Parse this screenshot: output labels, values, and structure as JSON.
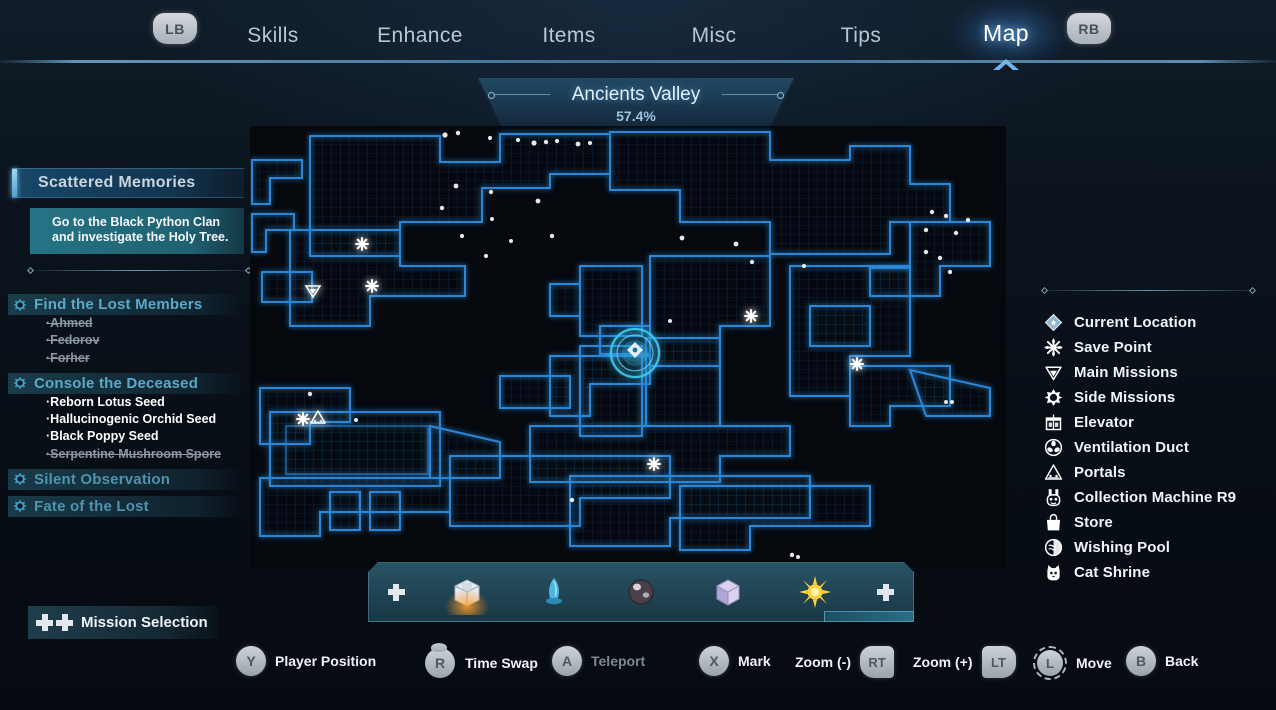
{
  "nav": {
    "left_bumper": "LB",
    "right_bumper": "RB",
    "tabs": [
      {
        "label": "Skills",
        "active": false
      },
      {
        "label": "Enhance",
        "active": false
      },
      {
        "label": "Items",
        "active": false
      },
      {
        "label": "Misc",
        "active": false
      },
      {
        "label": "Tips",
        "active": false
      },
      {
        "label": "Map",
        "active": true
      }
    ]
  },
  "quest": {
    "title": "Scattered Memories",
    "description": "Go to the Black Python Clan and investigate the Holy Tree.",
    "objectives": [
      {
        "name": "Find the Lost Members",
        "icon": "side-mission-icon",
        "items": [
          {
            "label": "Ahmed",
            "completed": true
          },
          {
            "label": "Fedorov",
            "completed": true
          },
          {
            "label": "Forher",
            "completed": true
          }
        ]
      },
      {
        "name": "Console the Deceased",
        "icon": "side-mission-icon",
        "items": [
          {
            "label": "Reborn Lotus Seed",
            "completed": false
          },
          {
            "label": "Hallucinogenic Orchid Seed",
            "completed": false
          },
          {
            "label": "Black Poppy Seed",
            "completed": false
          },
          {
            "label": "Serpentine Mushroom Spore",
            "completed": true
          }
        ]
      },
      {
        "name": "Silent Observation",
        "icon": "side-mission-icon",
        "items": []
      },
      {
        "name": "Fate of the Lost",
        "icon": "side-mission-icon",
        "items": []
      }
    ],
    "mission_selection": "Mission Selection"
  },
  "map": {
    "region_name": "Ancients Valley",
    "completion": "57.4%",
    "accent_color": "#4a9fd0",
    "wall_color": "#1e6fb8",
    "background_color": "#05080d"
  },
  "legend": {
    "entries": [
      {
        "label": "Current Location",
        "icon": "current-location-icon"
      },
      {
        "label": "Save Point",
        "icon": "save-point-icon"
      },
      {
        "label": "Main Missions",
        "icon": "main-mission-icon"
      },
      {
        "label": "Side Missions",
        "icon": "side-mission-icon"
      },
      {
        "label": "Elevator",
        "icon": "elevator-icon"
      },
      {
        "label": "Ventilation Duct",
        "icon": "ventilation-duct-icon"
      },
      {
        "label": "Portals",
        "icon": "portal-icon"
      },
      {
        "label": "Collection Machine R9",
        "icon": "collection-machine-icon"
      },
      {
        "label": "Store",
        "icon": "store-icon"
      },
      {
        "label": "Wishing Pool",
        "icon": "wishing-pool-icon"
      },
      {
        "label": "Cat Shrine",
        "icon": "cat-shrine-icon"
      }
    ]
  },
  "itembar": {
    "prev_icon": "dpad-left-icon",
    "next_icon": "dpad-right-icon",
    "items": [
      {
        "icon": "white-box-icon",
        "selected": true
      },
      {
        "icon": "blue-crystal-icon",
        "selected": false
      },
      {
        "icon": "dark-orb-icon",
        "selected": false
      },
      {
        "icon": "purple-cube-icon",
        "selected": false
      },
      {
        "icon": "yellow-star-icon",
        "selected": false
      }
    ]
  },
  "hints": [
    {
      "button": "Y",
      "label": "Player Position",
      "type": "round",
      "disabled": false
    },
    {
      "button": "R",
      "label": "Time Swap",
      "type": "rstick",
      "disabled": false
    },
    {
      "button": "A",
      "label": "Teleport",
      "type": "round",
      "disabled": true
    },
    {
      "button": "X",
      "label": "Mark",
      "type": "round",
      "disabled": false
    },
    {
      "button": "RT",
      "label": "Zoom (-)",
      "type": "trigger-rt",
      "disabled": false
    },
    {
      "button": "LT",
      "label": "Zoom (+)",
      "type": "trigger-lt",
      "disabled": false
    },
    {
      "button": "L",
      "label": "Move",
      "type": "stick",
      "disabled": false
    },
    {
      "button": "B",
      "label": "Back",
      "type": "round",
      "disabled": false
    }
  ]
}
